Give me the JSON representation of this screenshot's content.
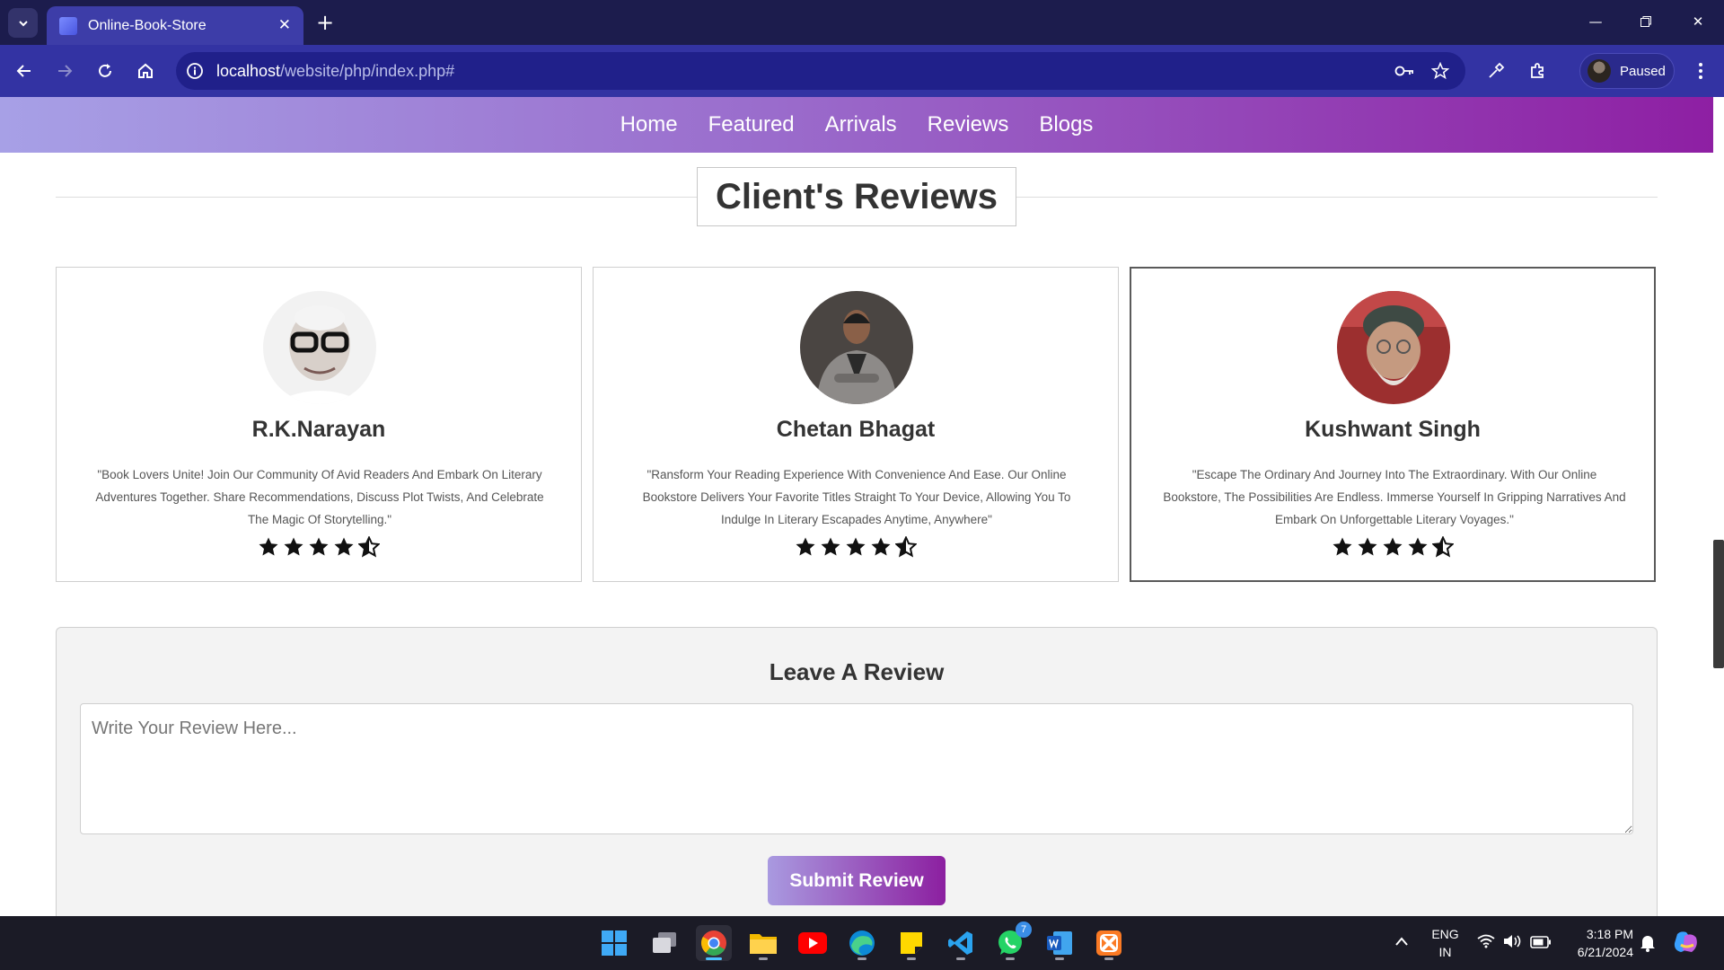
{
  "browser": {
    "tab_title": "Online-Book-Store",
    "url_host": "localhost",
    "url_path": "/website/php/index.php#",
    "profile_label": "Paused"
  },
  "nav": {
    "items": [
      {
        "label": "Home"
      },
      {
        "label": "Featured"
      },
      {
        "label": "Arrivals"
      },
      {
        "label": "Reviews"
      },
      {
        "label": "Blogs"
      }
    ]
  },
  "reviews": {
    "heading": "Client's Reviews",
    "items": [
      {
        "name": "R.K.Narayan",
        "quote": "\"Book Lovers Unite! Join Our Community Of Avid Readers And Embark On Literary Adventures Together. Share Recommendations, Discuss Plot Twists, And Celebrate The Magic Of Storytelling.\"",
        "rating": 4.5
      },
      {
        "name": "Chetan Bhagat",
        "quote": "\"Ransform Your Reading Experience With Convenience And Ease. Our Online Bookstore Delivers Your Favorite Titles Straight To Your Device, Allowing You To Indulge In Literary Escapades Anytime, Anywhere\"",
        "rating": 4.5
      },
      {
        "name": "Kushwant Singh",
        "quote": "\"Escape The Ordinary And Journey Into The Extraordinary. With Our Online Bookstore, The Possibilities Are Endless. Immerse Yourself In Gripping Narratives And Embark On Unforgettable Literary Voyages.\"",
        "rating": 4.5
      }
    ]
  },
  "leave_review": {
    "title": "Leave A Review",
    "placeholder": "Write Your Review Here...",
    "submit_label": "Submit Review"
  },
  "taskbar": {
    "whatsapp_badge": "7",
    "lang_top": "ENG",
    "lang_bottom": "IN",
    "time": "3:18 PM",
    "date": "6/21/2024"
  },
  "colors": {
    "nav_gradient_start": "#a7a0e6",
    "nav_gradient_end": "#8e1fa3",
    "chrome_tabbar": "#1c1c4d",
    "chrome_toolbar": "#3333a3"
  }
}
